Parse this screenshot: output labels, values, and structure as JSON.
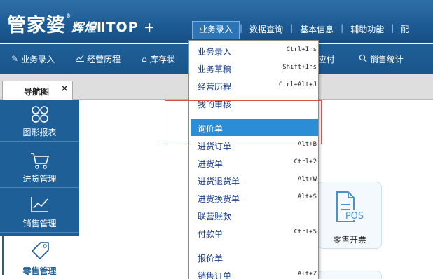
{
  "app": {
    "logo_name": "管家婆",
    "logo_reg": "®",
    "logo_edition": "辉煌",
    "logo_version": "ⅡTOP +"
  },
  "topmenu": [
    "业务录入",
    "数据查询",
    "基本信息",
    "辅助功能",
    "配"
  ],
  "toolbar": [
    {
      "label": "业务录入",
      "icon": "edit-icon"
    },
    {
      "label": "经营历程",
      "icon": "line-chart-icon"
    },
    {
      "label": "库存状",
      "icon": "home-icon"
    },
    {
      "label": "应付",
      "icon": "payable-icon"
    },
    {
      "label": "销售统计",
      "icon": "search-icon"
    }
  ],
  "tab": {
    "label": "导航图",
    "close": "✕"
  },
  "leftnav": [
    {
      "label": "图形报表",
      "icon": "grid-icon"
    },
    {
      "label": "进货管理",
      "icon": "cart-icon"
    },
    {
      "label": "销售管理",
      "icon": "line-chart-icon"
    },
    {
      "label": "零售管理",
      "icon": "price-tag-icon"
    }
  ],
  "tile": {
    "label": "零售开票",
    "icon_text": "POS"
  },
  "dropdown": {
    "items": [
      {
        "label": "业务录入",
        "shortcut": "Ctrl+Ins"
      },
      {
        "label": "业务草稿",
        "shortcut": "Shift+Ins"
      },
      {
        "label": "经营历程",
        "shortcut": "Ctrl+Alt+J"
      },
      {
        "label": "我的审核",
        "shortcut": ""
      },
      {
        "label": "询价单",
        "shortcut": ""
      },
      {
        "label": "进货订单",
        "shortcut": "Alt+B"
      },
      {
        "label": "进货单",
        "shortcut": "Ctrl+2"
      },
      {
        "label": "进货退货单",
        "shortcut": "Alt+W"
      },
      {
        "label": "进货换货单",
        "shortcut": "Alt+S"
      },
      {
        "label": "联营账款",
        "shortcut": ""
      },
      {
        "label": "付款单",
        "shortcut": "Ctrl+5"
      },
      {
        "label": "报价单",
        "shortcut": ""
      },
      {
        "label": "销售订单",
        "shortcut": "Alt+Z"
      }
    ],
    "highlighted": "询价单"
  },
  "colors": {
    "header": "#1d5a93",
    "highlight": "#2b8dd6",
    "annotation": "#e0504a"
  }
}
